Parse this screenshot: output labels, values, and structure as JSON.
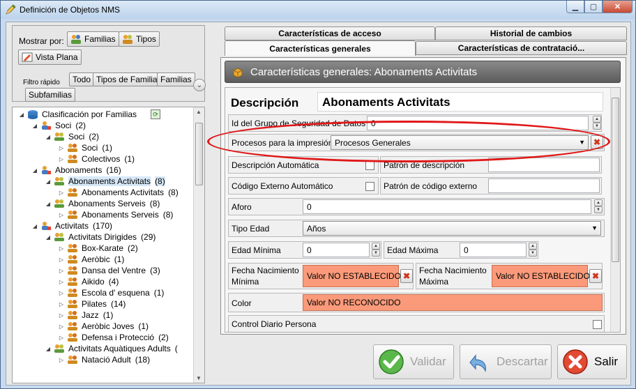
{
  "window": {
    "title": "Definición de Objetos NMS",
    "controls": [
      "minimize",
      "maximize",
      "close"
    ]
  },
  "left": {
    "mostrar_por": "Mostrar por:",
    "familias_btn": "Familias",
    "tipos_btn": "Tipos",
    "vista_plana_btn": "Vista Plana",
    "filtro_label": "Filtro rápido",
    "filtros": [
      "Todo",
      "Tipos de Familia",
      "Familias",
      "Subfamilias"
    ]
  },
  "tree": [
    {
      "label": "Clasificación por Familias",
      "count": "",
      "level": 0,
      "arrow": "◢",
      "icon": "database-icon"
    },
    {
      "label": "Soci",
      "count": "(2)",
      "level": 1,
      "arrow": "◢",
      "icon": "family-type-icon"
    },
    {
      "label": "Soci",
      "count": "(2)",
      "level": 2,
      "arrow": "◢",
      "icon": "family-icon"
    },
    {
      "label": "Soci",
      "count": "(1)",
      "level": 3,
      "arrow": "▷",
      "icon": "subfamily-icon"
    },
    {
      "label": "Colectivos",
      "count": "(1)",
      "level": 3,
      "arrow": "▷",
      "icon": "subfamily-icon"
    },
    {
      "label": "Abonaments",
      "count": "(16)",
      "level": 1,
      "arrow": "◢",
      "icon": "family-type-icon"
    },
    {
      "label": "Abonaments Activitats",
      "count": "(8)",
      "level": 2,
      "arrow": "◢",
      "icon": "family-icon",
      "selected": true
    },
    {
      "label": "Abonaments Activitats",
      "count": "(8)",
      "level": 3,
      "arrow": "▷",
      "icon": "subfamily-icon"
    },
    {
      "label": "Abonaments Serveis",
      "count": "(8)",
      "level": 2,
      "arrow": "◢",
      "icon": "family-icon"
    },
    {
      "label": "Abonaments Serveis",
      "count": "(8)",
      "level": 3,
      "arrow": "▷",
      "icon": "subfamily-icon"
    },
    {
      "label": "Activitats",
      "count": "(170)",
      "level": 1,
      "arrow": "◢",
      "icon": "family-type-icon"
    },
    {
      "label": "Activitats Dirigides",
      "count": "(29)",
      "level": 2,
      "arrow": "◢",
      "icon": "family-icon"
    },
    {
      "label": "Box-Karate",
      "count": "(2)",
      "level": 3,
      "arrow": "▷",
      "icon": "subfamily-icon"
    },
    {
      "label": "Aeròbic",
      "count": "(1)",
      "level": 3,
      "arrow": "▷",
      "icon": "subfamily-icon"
    },
    {
      "label": "Dansa del Ventre",
      "count": "(3)",
      "level": 3,
      "arrow": "▷",
      "icon": "subfamily-icon"
    },
    {
      "label": "Aikido",
      "count": "(4)",
      "level": 3,
      "arrow": "▷",
      "icon": "subfamily-icon"
    },
    {
      "label": "Escola d' esquena",
      "count": "(1)",
      "level": 3,
      "arrow": "▷",
      "icon": "subfamily-icon"
    },
    {
      "label": "Pilates",
      "count": "(14)",
      "level": 3,
      "arrow": "▷",
      "icon": "subfamily-icon"
    },
    {
      "label": "Jazz",
      "count": "(1)",
      "level": 3,
      "arrow": "▷",
      "icon": "subfamily-icon"
    },
    {
      "label": "Aeròbic Joves",
      "count": "(1)",
      "level": 3,
      "arrow": "▷",
      "icon": "subfamily-icon"
    },
    {
      "label": "Defensa i Protecció",
      "count": "(2)",
      "level": 3,
      "arrow": "▷",
      "icon": "subfamily-icon"
    },
    {
      "label": "Activitats Aquàtiques Adults",
      "count": "(",
      "level": 2,
      "arrow": "◢",
      "icon": "family-icon"
    },
    {
      "label": "Natació Adult",
      "count": "(18)",
      "level": 3,
      "arrow": "▷",
      "icon": "subfamily-icon"
    }
  ],
  "tabs": {
    "acceso": "Características de acceso",
    "historial": "Historial de cambios",
    "generales": "Características generales",
    "contratacion": "Características de contratació..."
  },
  "header": {
    "title": "Características generales:  Abonaments Activitats"
  },
  "form": {
    "descripcion_label": "Descripción",
    "descripcion_value": "Abonaments Activitats",
    "id_grupo_label": "Id del Grupo de Seguridad de Datos",
    "id_grupo_value": "0",
    "procesos_label": "Procesos para la impresión",
    "procesos_value": "Procesos Generales",
    "desc_auto_label": "Descripción Automática",
    "patron_desc_label": "Patrón de descripción",
    "patron_desc_value": "",
    "cod_ext_label": "Código Externo Automático",
    "patron_cod_label": "Patrón de código externo",
    "patron_cod_value": "",
    "aforo_label": "Aforo",
    "aforo_value": "0",
    "tipo_edad_label": "Tipo Edad",
    "tipo_edad_value": "Años",
    "edad_min_label": "Edad Mínima",
    "edad_min_value": "0",
    "edad_max_label": "Edad Máxima",
    "edad_max_value": "0",
    "fecha_min_label_1": "Fecha Nacimiento",
    "fecha_min_label_2": "Mínima",
    "fecha_min_value": "Valor NO ESTABLECIDO",
    "fecha_max_label_1": "Fecha Nacimiento",
    "fecha_max_label_2": "Máxima",
    "fecha_max_value": "Valor NO ESTABLECIDO",
    "color_label": "Color",
    "color_value": "Valor NO RECONOCIDO",
    "control_label": "Control Diario Persona"
  },
  "buttons": {
    "validar": "Validar",
    "descartar": "Descartar",
    "salir": "Salir"
  },
  "colors": {
    "warning_fill": "#fa9a7a",
    "highlight_ring": "#e01818",
    "header_bar": "#6e6e6e"
  }
}
